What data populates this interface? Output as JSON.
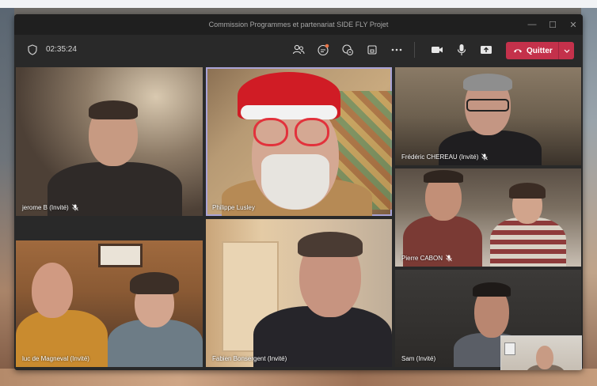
{
  "window": {
    "title": "Commission Programmes et partenariat SIDE FLY Projet",
    "controls": [
      "minimize",
      "maximize",
      "close"
    ]
  },
  "toolbar": {
    "timer": "02:35:24",
    "icons": [
      "participants-icon",
      "chat-icon",
      "reactions-icon",
      "rooms-icon",
      "more-icon"
    ],
    "right_icons": [
      "camera-icon",
      "mic-icon",
      "share-icon"
    ],
    "leave_label": "Quitter"
  },
  "participants": [
    {
      "name": "jerome B (Invité)",
      "muted": true
    },
    {
      "name": "Philippe Lusley",
      "muted": false,
      "active_speaker": true
    },
    {
      "name": "Frédéric CHEREAU (Invité)",
      "muted": true
    },
    {
      "name": "Pierre CABON",
      "muted": true
    },
    {
      "name": "luc de Magneval (Invité)",
      "muted": false
    },
    {
      "name": "Fabien Bonsergent (Invité)",
      "muted": false
    },
    {
      "name": "Sam (Invité)",
      "muted": false
    }
  ],
  "colors": {
    "leave": "#c4314b",
    "active_border": "#a9a3d6",
    "titlebar": "#1f1f1f",
    "toolbar": "#292929"
  }
}
